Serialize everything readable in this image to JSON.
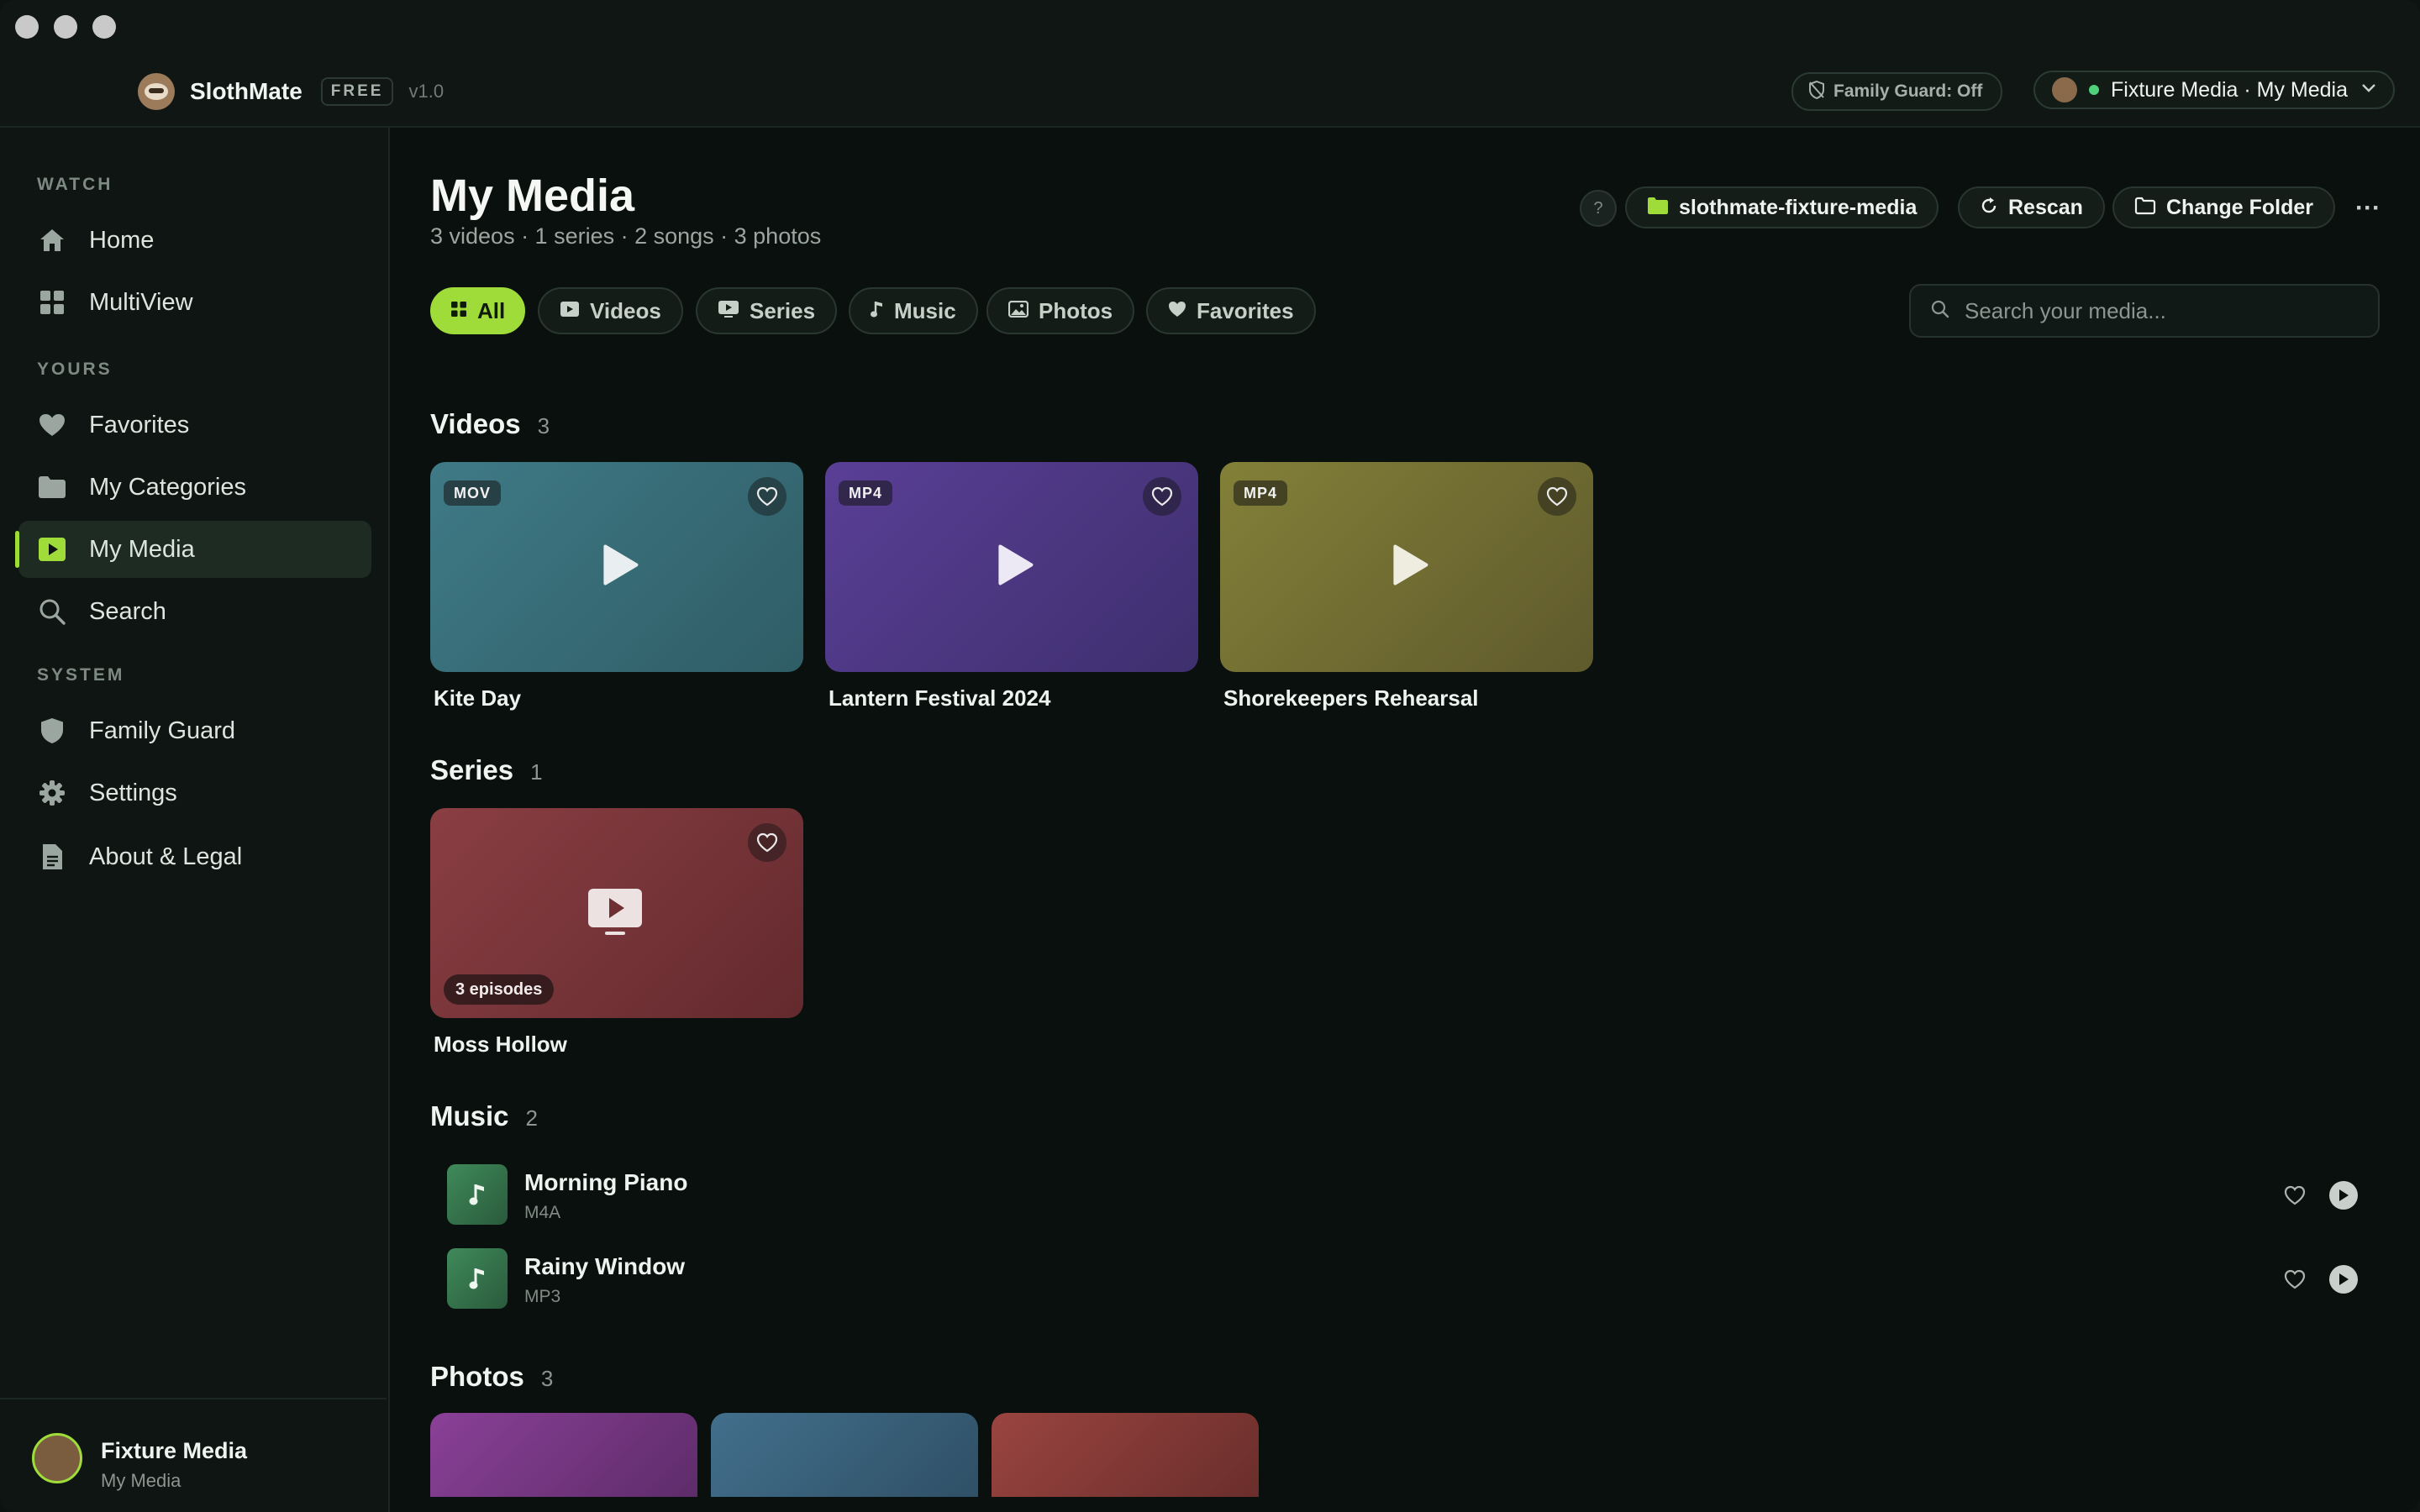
{
  "app": {
    "name": "SlothMate",
    "plan": "FREE",
    "version": "v1.0",
    "family_guard_status": "Family Guard: Off",
    "account": "Fixture Media · My Media"
  },
  "sidebar": {
    "sections": [
      {
        "label": "WATCH"
      },
      {
        "label": "YOURS"
      },
      {
        "label": "SYSTEM"
      }
    ],
    "items": [
      {
        "label": "Home",
        "icon": "home-icon"
      },
      {
        "label": "MultiView",
        "icon": "grid-icon"
      },
      {
        "label": "Favorites",
        "icon": "heart-icon"
      },
      {
        "label": "My Categories",
        "icon": "folder-icon"
      },
      {
        "label": "My Media",
        "icon": "play-square-icon",
        "active": true
      },
      {
        "label": "Search",
        "icon": "search-icon"
      },
      {
        "label": "Family Guard",
        "icon": "shield-icon"
      },
      {
        "label": "Settings",
        "icon": "gear-icon"
      },
      {
        "label": "About & Legal",
        "icon": "document-icon"
      }
    ],
    "user": {
      "name": "Fixture Media",
      "subtitle": "My Media"
    }
  },
  "header": {
    "title": "My Media",
    "summary": "3 videos · 1 series · 2 songs · 3 photos",
    "help": "?",
    "folder_button": "slothmate-fixture-media",
    "rescan_button": "Rescan",
    "change_folder_button": "Change Folder",
    "more": "···"
  },
  "filters": [
    {
      "label": "All",
      "active": true
    },
    {
      "label": "Videos"
    },
    {
      "label": "Series"
    },
    {
      "label": "Music"
    },
    {
      "label": "Photos"
    },
    {
      "label": "Favorites"
    }
  ],
  "search": {
    "placeholder": "Search your media..."
  },
  "videos": {
    "title": "Videos",
    "count": "3",
    "items": [
      {
        "title": "Kite Day",
        "format": "MOV",
        "color": "#3d7480"
      },
      {
        "title": "Lantern Festival 2024",
        "format": "MP4",
        "color": "#4f3a8a"
      },
      {
        "title": "Shorekeepers Rehearsal",
        "format": "MP4",
        "color": "#7b7430"
      }
    ]
  },
  "series": {
    "title": "Series",
    "count": "1",
    "items": [
      {
        "title": "Moss Hollow",
        "episodes": "3 episodes",
        "color": "#7e3438"
      }
    ]
  },
  "music": {
    "title": "Music",
    "count": "2",
    "items": [
      {
        "title": "Morning Piano",
        "format": "M4A"
      },
      {
        "title": "Rainy Window",
        "format": "MP3"
      }
    ]
  },
  "photos": {
    "title": "Photos",
    "count": "3",
    "colors": [
      "#7a3a86",
      "#3a6682",
      "#8a3c38"
    ]
  },
  "colors": {
    "accent": "#9fdc3a",
    "background": "#0a100d"
  }
}
